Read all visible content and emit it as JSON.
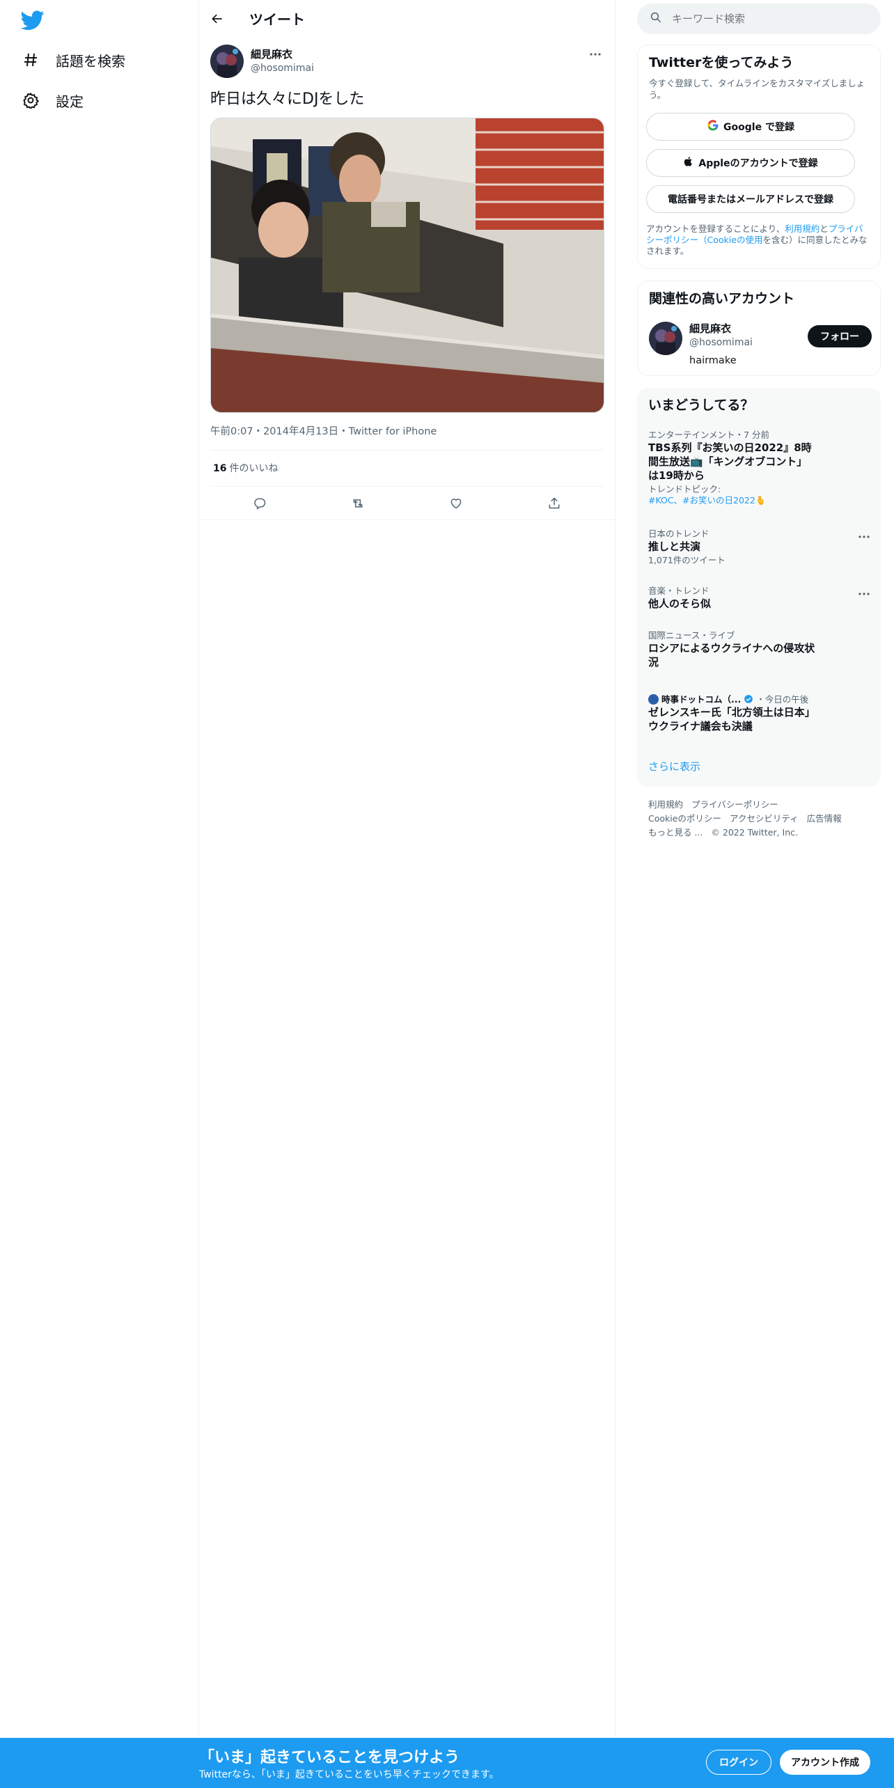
{
  "sidebar": {
    "items": [
      {
        "label": "話題を検索",
        "icon": "hashtag-icon"
      },
      {
        "label": "設定",
        "icon": "gear-icon"
      }
    ]
  },
  "header": {
    "title": "ツイート"
  },
  "tweet": {
    "author_name": "細見麻衣",
    "author_handle": "@hosomimai",
    "text": "昨日は久々にDJをした",
    "time": "午前0:07",
    "date": "2014年4月13日",
    "source": "Twitter for iPhone",
    "likes_count": "16",
    "likes_label": "件のいいね"
  },
  "search": {
    "placeholder": "キーワード検索"
  },
  "signup": {
    "title": "Twitterを使ってみよう",
    "subtitle": "今すぐ登録して、タイムラインをカスタマイズしましょう。",
    "google_label": "Google で登録",
    "apple_label": "Appleのアカウントで登録",
    "phone_label": "電話番号またはメールアドレスで登録",
    "terms_prefix": "アカウントを登録することにより、",
    "terms_link": "利用規約",
    "terms_and": "と",
    "privacy_link": "プライバシーポリシー",
    "cookie_open": "（",
    "cookie_link": "Cookieの使用",
    "terms_suffix": "を含む）に同意したとみなされます。"
  },
  "related": {
    "title": "関連性の高いアカウント",
    "name": "細見麻衣",
    "handle": "@hosomimai",
    "bio": "hairmake",
    "follow_label": "フォロー"
  },
  "trends": {
    "title": "いまどうしてる？",
    "items": [
      {
        "context": "エンターテインメント・7 分前",
        "title": "TBS系列『お笑いの日2022』8時間生放送📺「キングオブコント」は19時から",
        "sub": "トレンドトピック:",
        "tags": "#KOC、#お笑いの日2022🫰"
      },
      {
        "context": "日本のトレンド",
        "title": "推しと共演",
        "sub": "1,071件のツイート"
      },
      {
        "context": "音楽・トレンド",
        "title": "他人のそら似"
      },
      {
        "context": "国際ニュース・ライブ",
        "title": "ロシアによるウクライナへの侵攻状況"
      },
      {
        "context": "時事ドットコム（...",
        "context2": "・今日の午後",
        "title": "ゼレンスキー氏「北方領土は日本」　ウクライナ議会も決議"
      }
    ],
    "show_more": "さらに表示"
  },
  "footer": {
    "links": [
      "利用規約",
      "プライバシーポリシー",
      "Cookieのポリシー",
      "アクセシビリティ",
      "広告情報",
      "もっと見る ..."
    ],
    "copyright": "© 2022 Twitter, Inc."
  },
  "banner": {
    "title": "「いま」起きていることを見つけよう",
    "subtitle": "Twitterなら、「いま」起きていることをいち早くチェックできます。",
    "login_label": "ログイン",
    "create_label": "アカウント作成"
  },
  "colors": {
    "accent": "#1d9bf0",
    "text": "#0f1419",
    "muted": "#536471"
  }
}
